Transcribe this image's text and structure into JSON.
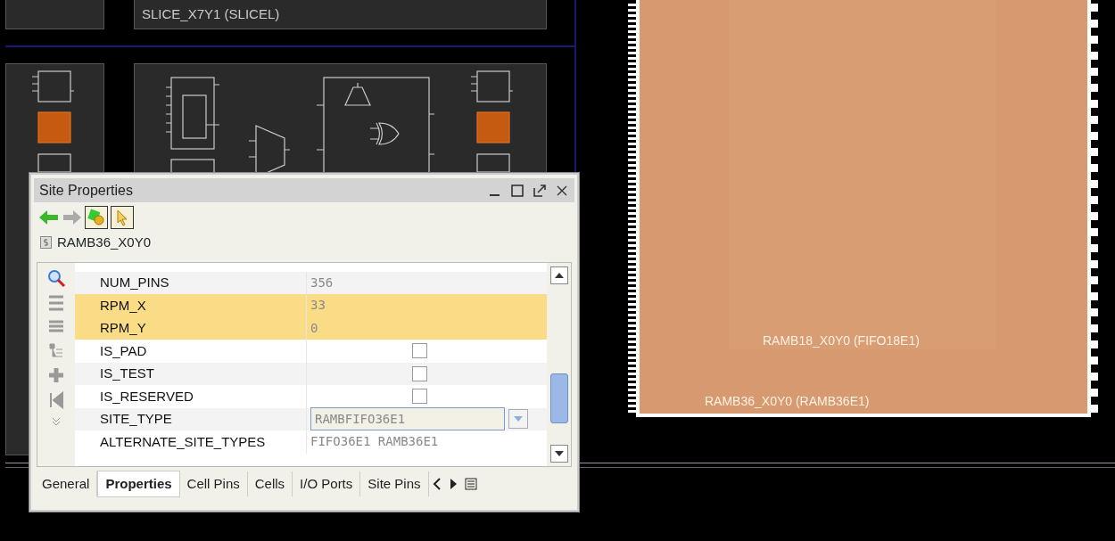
{
  "device_view": {
    "slice_label": "SLICE_X7Y1 (SLICEL)",
    "ram_labels": [
      "RAMB18_X0Y0 (FIFO18E1)",
      "RAMB36_X0Y0 (RAMB36E1)"
    ]
  },
  "dialog": {
    "title": "Site Properties",
    "site_name": "RAMB36_X0Y0",
    "properties": [
      {
        "kind": "text",
        "name": "NUM_PINS",
        "value": "356",
        "highlighted": false
      },
      {
        "kind": "text",
        "name": "RPM_X",
        "value": "33",
        "highlighted": true
      },
      {
        "kind": "text",
        "name": "RPM_Y",
        "value": "0",
        "highlighted": true
      },
      {
        "kind": "checkbox",
        "name": "IS_PAD",
        "checked": false,
        "highlighted": false
      },
      {
        "kind": "checkbox",
        "name": "IS_TEST",
        "checked": false,
        "highlighted": false
      },
      {
        "kind": "checkbox",
        "name": "IS_RESERVED",
        "checked": false,
        "highlighted": false
      },
      {
        "kind": "dropdown",
        "name": "SITE_TYPE",
        "value": "RAMBFIFO36E1",
        "highlighted": false
      },
      {
        "kind": "text",
        "name": "ALTERNATE_SITE_TYPES",
        "value": "FIFO36E1 RAMB36E1",
        "highlighted": false
      }
    ],
    "tabs": [
      {
        "label": "General",
        "selected": false
      },
      {
        "label": "Properties",
        "selected": true
      },
      {
        "label": "Cell Pins",
        "selected": false
      },
      {
        "label": "Cells",
        "selected": false
      },
      {
        "label": "I/O Ports",
        "selected": false
      },
      {
        "label": "Site Pins",
        "selected": false
      }
    ]
  }
}
